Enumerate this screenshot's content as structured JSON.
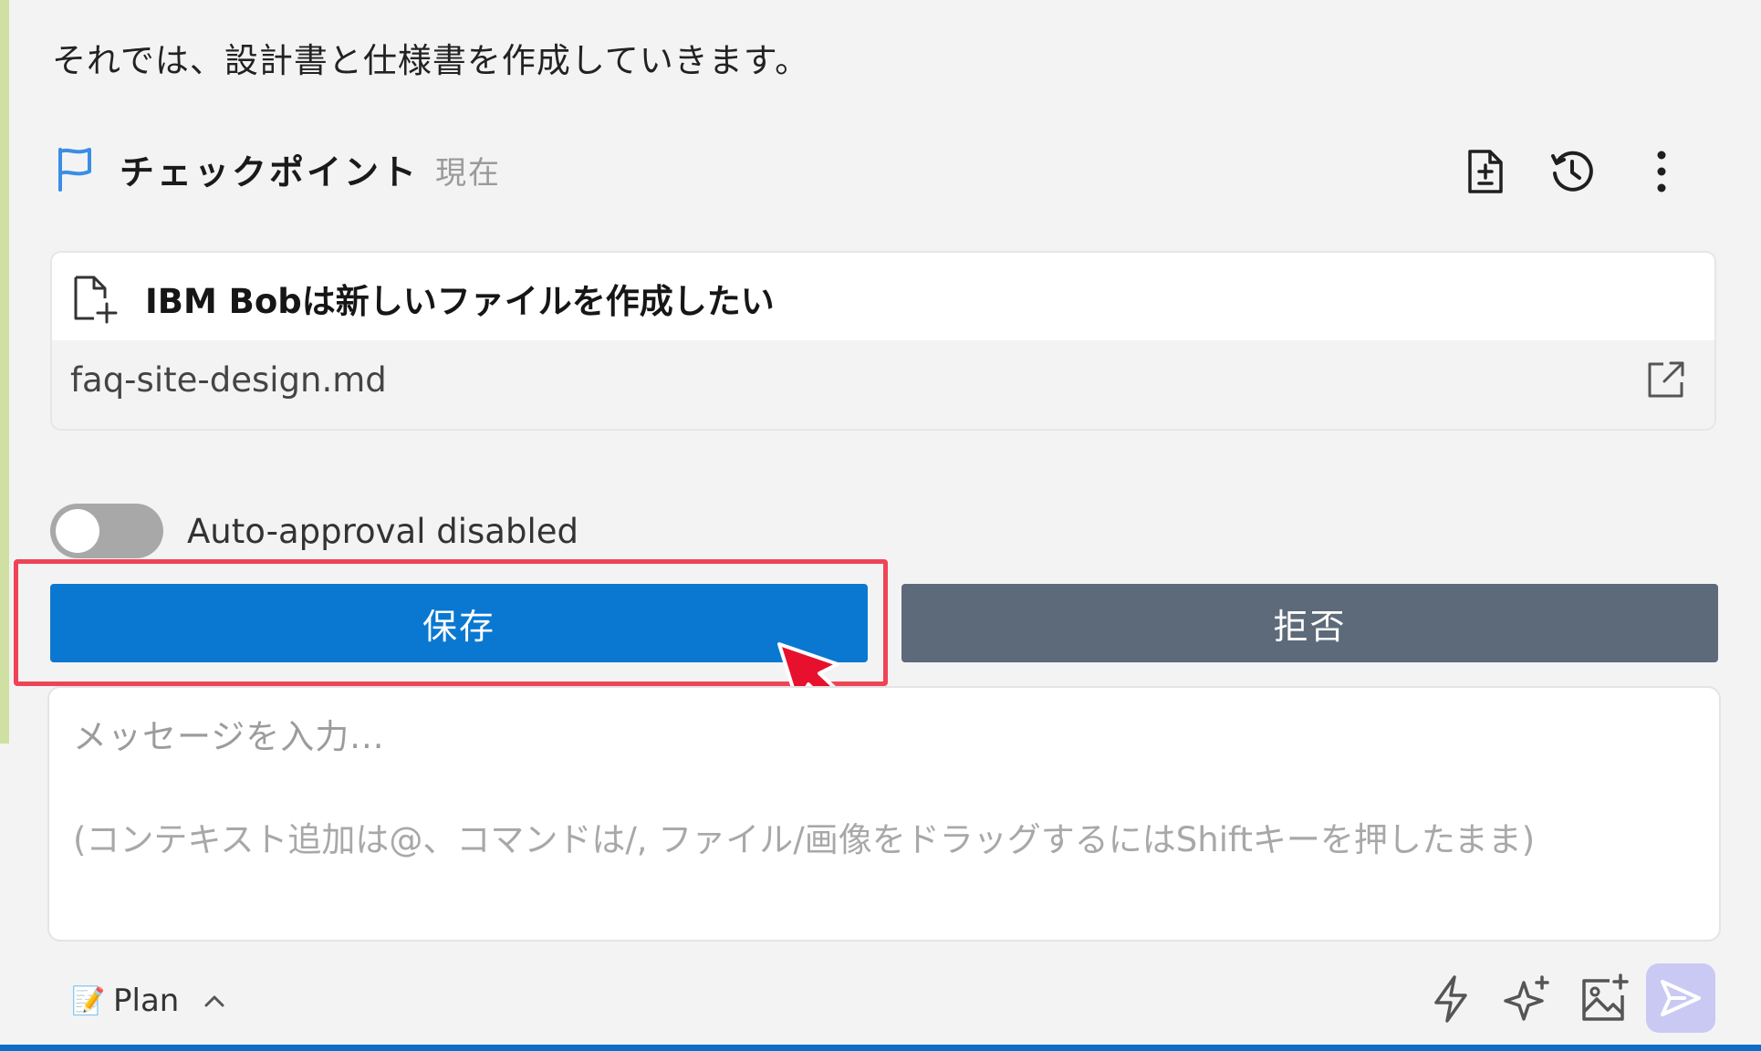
{
  "intro": {
    "text": "それでは、設計書と仕様書を作成していきます。"
  },
  "checkpoint": {
    "label": "チェックポイント",
    "status": "現在",
    "icons": [
      "flag-icon",
      "file-diff-icon",
      "history-icon",
      "more-vertical-icon"
    ]
  },
  "file_card": {
    "title": "IBM Bobは新しいファイルを作成したい",
    "file_name": "faq-site-design.md",
    "icons": [
      "file-add-icon",
      "open-external-icon"
    ]
  },
  "auto_approval": {
    "label": "Auto-approval disabled",
    "enabled": false
  },
  "actions": {
    "save_label": "保存",
    "reject_label": "拒否"
  },
  "message": {
    "placeholder": "メッセージを入力...",
    "hint": "(コンテキスト追加は@、コマンドは/, ファイル/画像をドラッグするにはShiftキーを押したまま)"
  },
  "toolbar": {
    "mode_emoji": "📝",
    "mode_label": "Plan",
    "icons": [
      "chevron-up-icon",
      "lightning-icon",
      "sparkle-icon",
      "add-image-icon",
      "send-icon"
    ]
  },
  "colors": {
    "save": "#0a78d0",
    "reject": "#5d6a7a",
    "highlight": "#ef4457",
    "flag": "#3b8de6",
    "send": "#c9c9f4"
  }
}
